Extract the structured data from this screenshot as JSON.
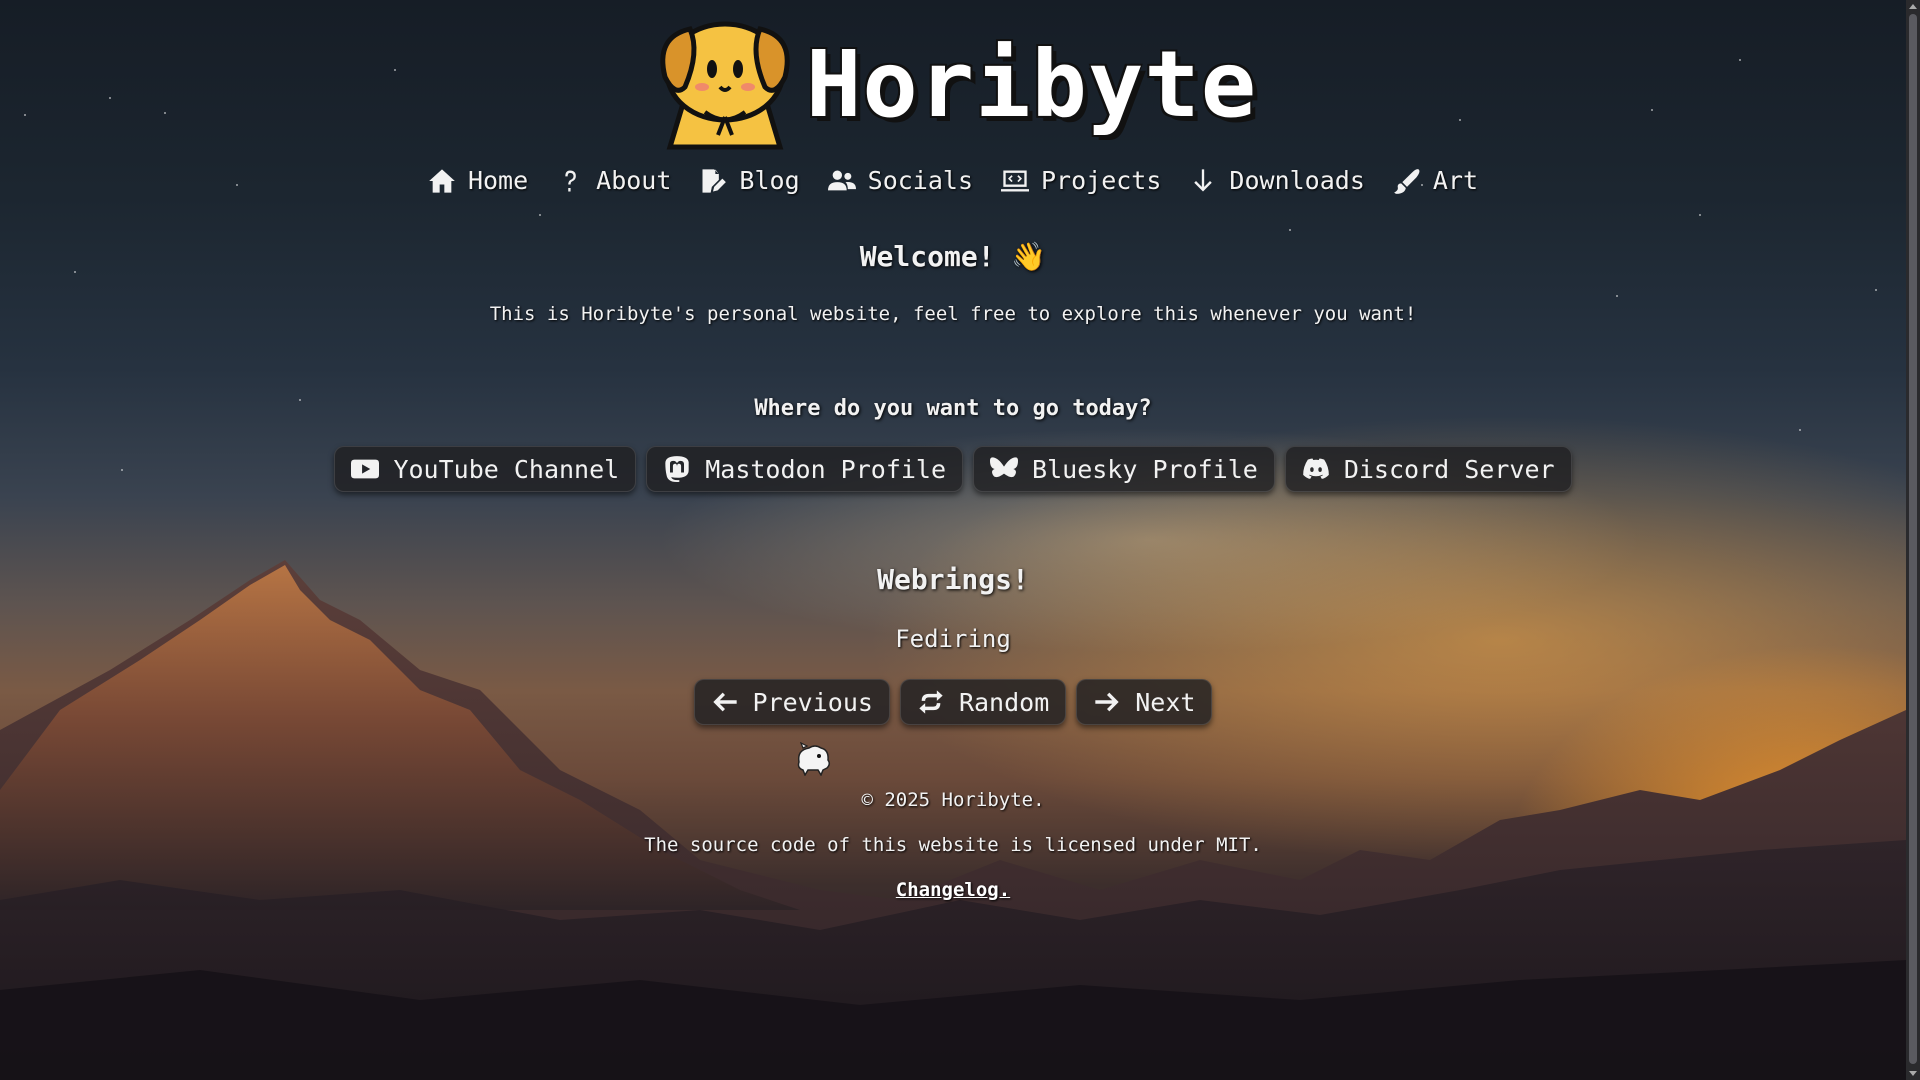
{
  "site": {
    "title": "Horibyte"
  },
  "nav": {
    "items": [
      {
        "label": "Home",
        "icon": "home-icon"
      },
      {
        "label": "About",
        "icon": "question-icon"
      },
      {
        "label": "Blog",
        "icon": "blog-icon"
      },
      {
        "label": "Socials",
        "icon": "users-icon"
      },
      {
        "label": "Projects",
        "icon": "projects-icon"
      },
      {
        "label": "Downloads",
        "icon": "download-icon"
      },
      {
        "label": "Art",
        "icon": "brush-icon"
      }
    ]
  },
  "welcome": {
    "heading": "Welcome! 👋",
    "intro": "This is Horibyte's personal website, feel free to explore this whenever you want!"
  },
  "destinations": {
    "heading": "Where do you want to go today?",
    "buttons": [
      {
        "label": "YouTube Channel",
        "icon": "youtube-icon"
      },
      {
        "label": "Mastodon Profile",
        "icon": "mastodon-icon"
      },
      {
        "label": "Bluesky Profile",
        "icon": "bluesky-icon"
      },
      {
        "label": "Discord Server",
        "icon": "discord-icon"
      }
    ]
  },
  "webrings": {
    "heading": "Webrings!",
    "ring_name": "Fediring",
    "previous_label": "Previous",
    "random_label": "Random",
    "next_label": "Next"
  },
  "footer": {
    "copyright": "© 2025 Horibyte.",
    "license": "The source code of this website is licensed under MIT.",
    "changelog": "Changelog."
  },
  "colors": {
    "text": "#f2f2f2",
    "button_bg": "#202022",
    "mascot_yellow": "#f5c242",
    "sun": "#ffd65a"
  }
}
